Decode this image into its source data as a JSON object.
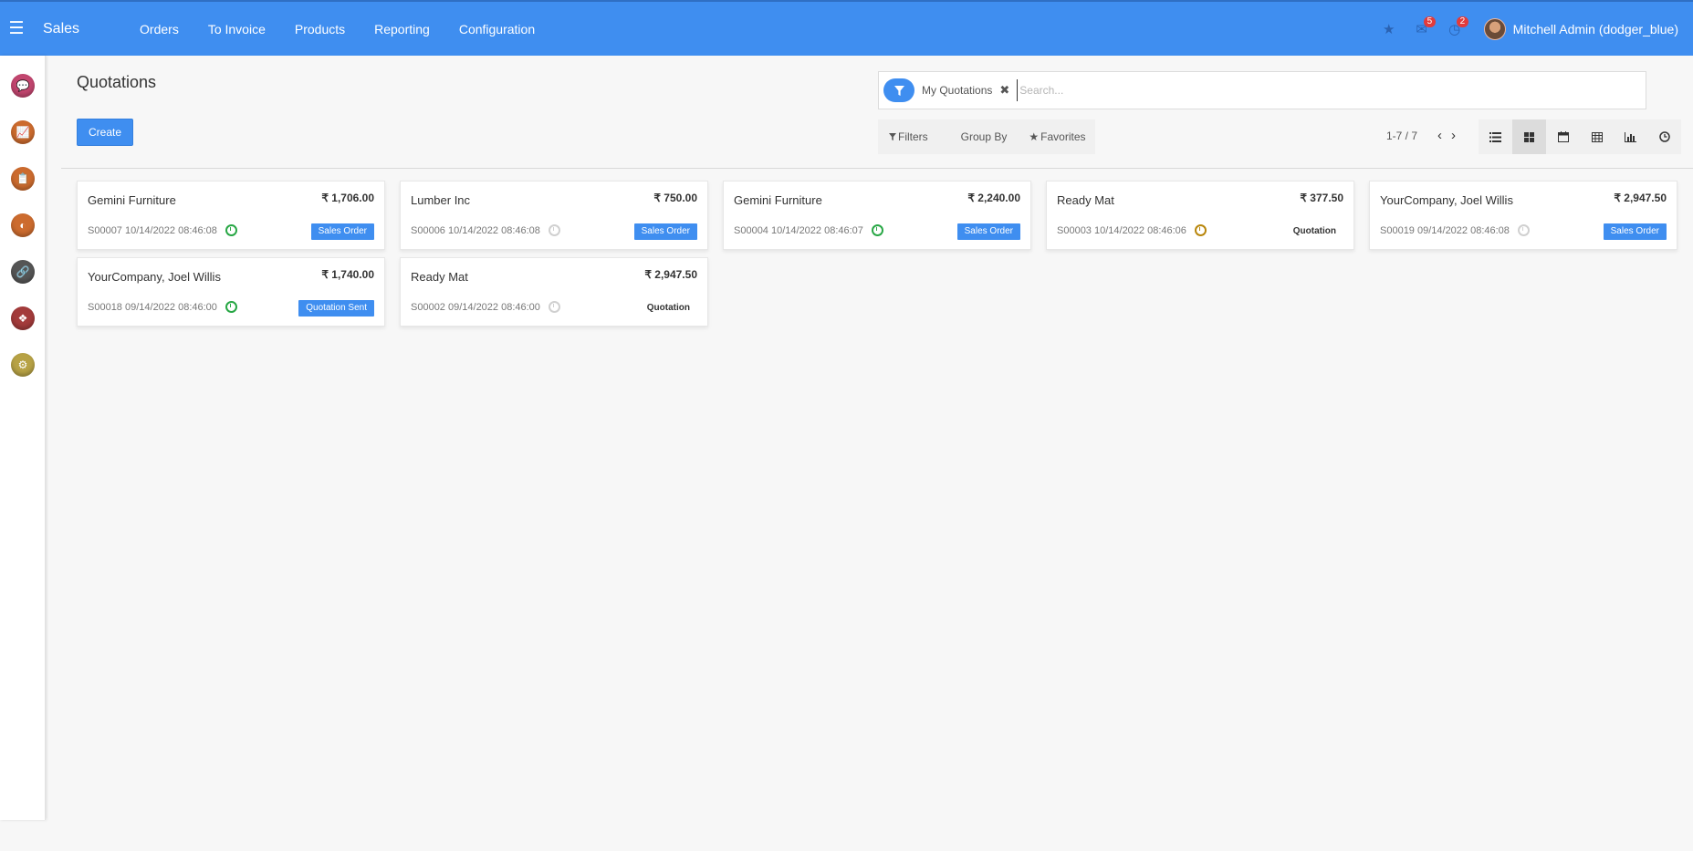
{
  "navbar": {
    "toggle_icon": "☰",
    "app_name": "Sales",
    "menu": [
      "Orders",
      "To Invoice",
      "Products",
      "Reporting",
      "Configuration"
    ],
    "icons": [
      {
        "name": "star-icon",
        "glyph": "★",
        "badge": ""
      },
      {
        "name": "chat-icon",
        "glyph": "✉",
        "badge": "5"
      },
      {
        "name": "activity-clock-icon",
        "glyph": "◷",
        "badge": "2"
      }
    ],
    "user_name": "Mitchell Admin (dodger_blue)"
  },
  "sidebar": {
    "apps": [
      {
        "name": "discuss-app-icon",
        "color": "#c2466f",
        "glyph": "💬"
      },
      {
        "name": "dashboard-app-icon",
        "color": "#cc6b2e",
        "glyph": "📈"
      },
      {
        "name": "invoicing-app-icon",
        "color": "#cc6b2e",
        "glyph": "📋"
      },
      {
        "name": "crm-app-icon",
        "color": "#cc6b2e",
        "glyph": "◐"
      },
      {
        "name": "link-app-icon",
        "color": "#555555",
        "glyph": "🔗"
      },
      {
        "name": "apps-app-icon",
        "color": "#a33b3b",
        "glyph": "❖"
      },
      {
        "name": "settings-app-icon",
        "color": "#b7a245",
        "glyph": "⚙"
      }
    ]
  },
  "control": {
    "title": "Quotations",
    "create_label": "Create",
    "search": {
      "facet_label": "My Quotations",
      "facet_remove": "✖",
      "placeholder": "Search..."
    },
    "filters_label": "Filters",
    "groupby_label": "Group By",
    "favorites_label": "Favorites",
    "pager": {
      "text": "1-7 / 7",
      "prev": "‹",
      "next": "›"
    },
    "views": [
      {
        "name": "list-view-button",
        "glyph": "☰",
        "active": false
      },
      {
        "name": "kanban-view-button",
        "glyph": "▦",
        "active": true
      },
      {
        "name": "calendar-view-button",
        "glyph": "▤",
        "active": false
      },
      {
        "name": "pivot-view-button",
        "glyph": "▥",
        "active": false
      },
      {
        "name": "graph-view-button",
        "glyph": "▮",
        "active": false
      },
      {
        "name": "activity-view-button",
        "glyph": "◷",
        "active": false
      }
    ]
  },
  "cards": [
    {
      "partner": "Gemini Furniture",
      "amount": "₹ 1,706.00",
      "ref": "S00007 10/14/2022 08:46:08",
      "clock": "green",
      "state": "Sales Order",
      "state_style": "blue"
    },
    {
      "partner": "Lumber Inc",
      "amount": "₹ 750.00",
      "ref": "S00006 10/14/2022 08:46:08",
      "clock": "gray",
      "state": "Sales Order",
      "state_style": "blue"
    },
    {
      "partner": "Gemini Furniture",
      "amount": "₹ 2,240.00",
      "ref": "S00004 10/14/2022 08:46:07",
      "clock": "green",
      "state": "Sales Order",
      "state_style": "blue"
    },
    {
      "partner": "Ready Mat",
      "amount": "₹ 377.50",
      "ref": "S00003 10/14/2022 08:46:06",
      "clock": "orange",
      "state": "Quotation",
      "state_style": "plain"
    },
    {
      "partner": "YourCompany, Joel Willis",
      "amount": "₹ 2,947.50",
      "ref": "S00019 09/14/2022 08:46:08",
      "clock": "gray",
      "state": "Sales Order",
      "state_style": "blue"
    },
    {
      "partner": "YourCompany, Joel Willis",
      "amount": "₹ 1,740.00",
      "ref": "S00018 09/14/2022 08:46:00",
      "clock": "green",
      "state": "Quotation Sent",
      "state_style": "blue"
    },
    {
      "partner": "Ready Mat",
      "amount": "₹ 2,947.50",
      "ref": "S00002 09/14/2022 08:46:00",
      "clock": "gray",
      "state": "Quotation",
      "state_style": "plain"
    }
  ]
}
